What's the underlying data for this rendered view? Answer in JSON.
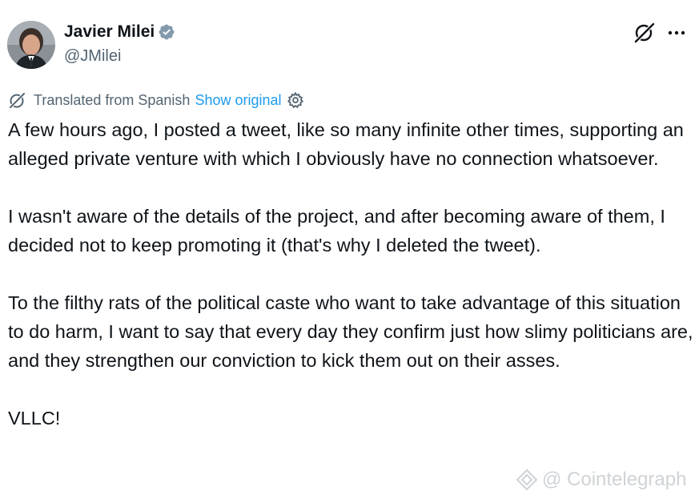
{
  "author": {
    "display_name": "Javier Milei",
    "handle": "@JMilei"
  },
  "translation": {
    "label": "Translated from Spanish",
    "show_original": "Show original"
  },
  "tweet": {
    "paragraphs": [
      "A few hours ago, I posted a tweet, like so many infinite other times, supporting an alleged private venture with which I obviously have no connection whatsoever.",
      "I wasn't aware of the details of the project, and after becoming aware of them, I decided not to keep promoting it (that's why I deleted the tweet).",
      "To the filthy rats of the political caste who want to take advantage of this situation to do harm, I want to say that every day they confirm just how slimy politicians are, and they strengthen our conviction to kick them out on their asses.",
      "VLLC!"
    ]
  },
  "watermark": {
    "text": "@ Cointelegraph"
  },
  "icons": {
    "verified": "verified-badge-icon",
    "grok": "grok-icon",
    "more": "more-icon",
    "translate": "translate-icon",
    "settings": "gear-icon"
  },
  "colors": {
    "text": "#0f1419",
    "secondary": "#536471",
    "link": "#1d9bf0",
    "verified": "#829aab"
  }
}
